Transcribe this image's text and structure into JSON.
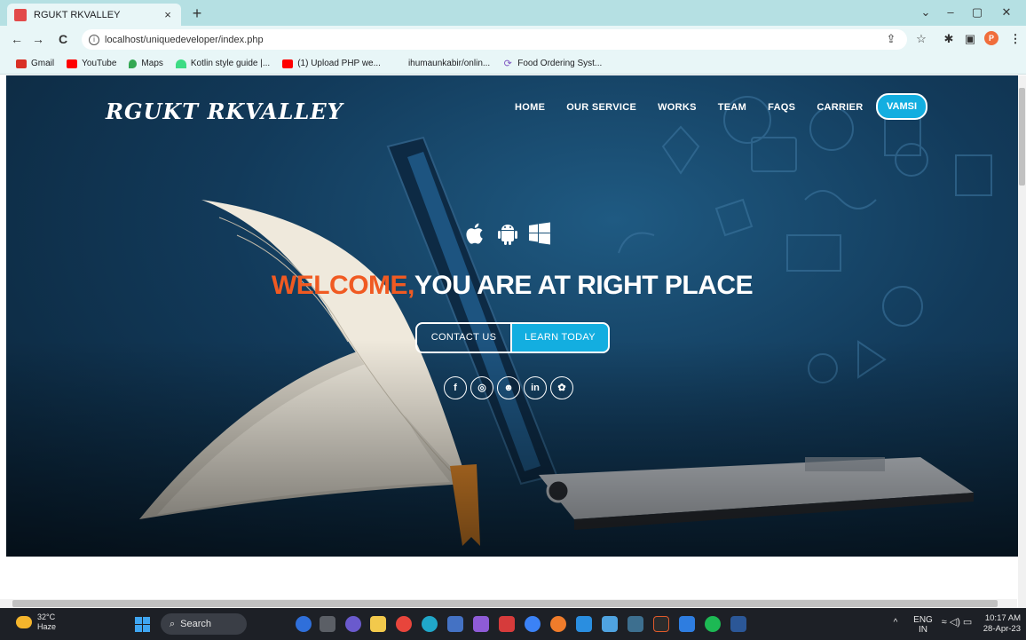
{
  "browser": {
    "tab_title": "RGUKT RKVALLEY",
    "tab_close": "×",
    "new_tab": "+",
    "window_minimize": "–",
    "window_restore": "▢",
    "window_close": "✕",
    "window_chevron": "⌄",
    "back": "←",
    "forward": "→",
    "reload": "C",
    "url": "localhost/uniquedeveloper/index.php",
    "share": "⇪",
    "bookmark_star": "☆",
    "extensions": "✱",
    "sidepanel": "▣",
    "profile_initial": "P",
    "menu": "⋮"
  },
  "bookmarks": [
    {
      "label": "Gmail",
      "color": "#d93025"
    },
    {
      "label": "YouTube",
      "color": "#ff0000"
    },
    {
      "label": "Maps",
      "color": "#34a853"
    },
    {
      "label": "Kotlin style guide |...",
      "color": "#3ddc84"
    },
    {
      "label": "(1) Upload PHP we...",
      "color": "#ff0000"
    },
    {
      "label": "ihumaunkabir/onlin...",
      "color": "#e8f6f7"
    },
    {
      "label": "Food Ordering Syst...",
      "color": "#7e57c2"
    }
  ],
  "site": {
    "brand": "RGUKT RKVALLEY",
    "menu": [
      "HOME",
      "OUR SERVICE",
      "WORKS",
      "TEAM",
      "FAQS",
      "CARRIER"
    ],
    "menu_cta": "VAMSI",
    "os_icons": [
      "apple-icon",
      "android-icon",
      "windows-icon"
    ],
    "headline_accent": "WELCOME,",
    "headline_main": "YOU ARE AT RIGHT PLACE",
    "cta_contact": "CONTACT US",
    "cta_learn": "LEARN TODAY",
    "socials": [
      {
        "icon": "facebook-icon",
        "glyph": "f"
      },
      {
        "icon": "instagram-icon",
        "glyph": "◎"
      },
      {
        "icon": "reddit-icon",
        "glyph": "☻"
      },
      {
        "icon": "linkedin-icon",
        "glyph": "in"
      },
      {
        "icon": "settings-icon",
        "glyph": "✿"
      }
    ],
    "accent_color": "#13aee0",
    "headline_accent_color": "#f05a22"
  },
  "taskbar": {
    "temperature": "32°C",
    "condition": "Haze",
    "search_label": "Search",
    "language": "ENG",
    "region": "IN",
    "time": "10:17 AM",
    "date": "28-Apr-23",
    "tray_up": "^"
  }
}
